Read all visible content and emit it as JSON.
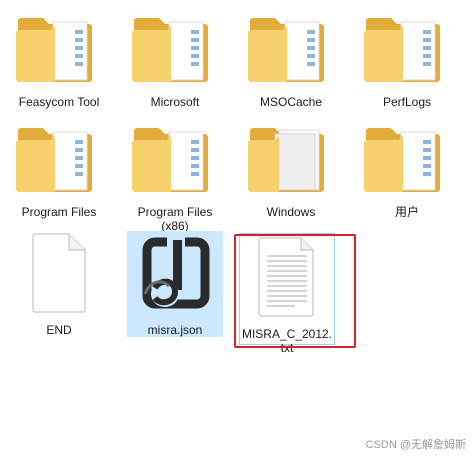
{
  "files": [
    {
      "name": "Feasycom Tool",
      "type": "folder",
      "selected": false
    },
    {
      "name": "Microsoft",
      "type": "folder",
      "selected": false
    },
    {
      "name": "MSOCache",
      "type": "folder",
      "selected": false
    },
    {
      "name": "PerfLogs",
      "type": "folder",
      "selected": false
    },
    {
      "name": "Program Files",
      "type": "folder",
      "selected": false
    },
    {
      "name": "Program Files (x86)",
      "type": "folder",
      "selected": false
    },
    {
      "name": "Windows",
      "type": "folder",
      "selected": false
    },
    {
      "name": "用户",
      "type": "folder",
      "selected": false
    },
    {
      "name": "END",
      "type": "file-blank",
      "selected": false
    },
    {
      "name": "misra.json",
      "type": "file-json",
      "selected": true
    },
    {
      "name": "MISRA_C_2012.txt",
      "type": "file-text",
      "selected": false,
      "highlighted": true
    }
  ],
  "labels": {
    "f0": "Feasycom Tool",
    "f1": "Microsoft",
    "f2": "MSOCache",
    "f3": "PerfLogs",
    "f4": "Program Files",
    "f5a": "Program Files",
    "f5b": "(x86)",
    "f6": "Windows",
    "f7": "用户",
    "f8": "END",
    "f9": "misra.json",
    "f10a": "MISRA_C_2012.",
    "f10b": "txt"
  },
  "watermark": "CSDN @无解詹姆斯",
  "colors": {
    "folder_back": "#e8b84a",
    "folder_front": "#f7d679",
    "selection": "#cce8ff",
    "highlight_border": "#d8222a"
  }
}
